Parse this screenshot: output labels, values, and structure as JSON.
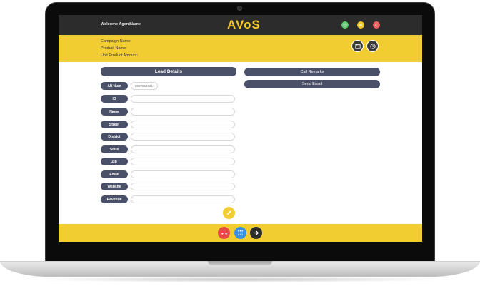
{
  "header": {
    "welcome": "Welcome AgentName",
    "logo": "AVoS",
    "icons": [
      "power-icon",
      "pause-icon",
      "logout-icon"
    ]
  },
  "info": {
    "campaign": "Campaign Name:",
    "product": "Product Name:",
    "amount": "Unit Product Amount:",
    "icons": [
      "calendar-icon",
      "clock-icon"
    ]
  },
  "lead": {
    "title": "Lead Details",
    "alt_num": {
      "label": "Alt Num",
      "value": "0987654321"
    },
    "fields": [
      {
        "label": "ID",
        "value": ""
      },
      {
        "label": "Name",
        "value": ""
      },
      {
        "label": "Street",
        "value": ""
      },
      {
        "label": "District",
        "value": ""
      },
      {
        "label": "State",
        "value": ""
      },
      {
        "label": "Zip",
        "value": ""
      },
      {
        "label": "Email",
        "value": ""
      },
      {
        "label": "Website",
        "value": ""
      },
      {
        "label": "Revenue",
        "value": ""
      }
    ]
  },
  "actions": {
    "call_remarks": "Call Remarks",
    "send_email": "Send Email"
  },
  "bottom": {
    "icons": [
      "hangup-icon",
      "dialpad-icon",
      "next-arrow-icon"
    ]
  },
  "colors": {
    "accent_yellow": "#f2cd32",
    "dark": "#2c2c2c",
    "label_bg": "#4a5068",
    "hangup": "#e84848",
    "dialpad": "#3b8fe0"
  }
}
